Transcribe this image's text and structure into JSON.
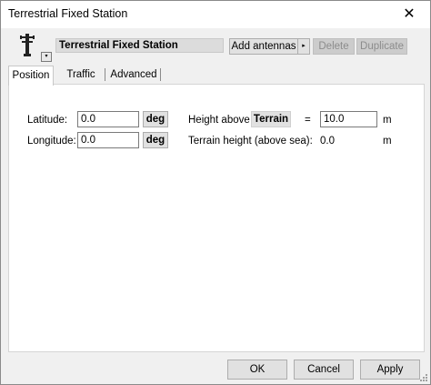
{
  "window": {
    "title": "Terrestrial Fixed Station",
    "close_glyph": "✕"
  },
  "header": {
    "icon": "radio-tower-icon",
    "dropdown_glyph": "▾",
    "station_name": "Terrestrial Fixed Station",
    "add_antennas_label": "Add antennas",
    "add_arrow_glyph": "▸",
    "delete_label": "Delete",
    "duplicate_label": "Duplicate"
  },
  "tabs": [
    {
      "label": "Position",
      "active": true
    },
    {
      "label": "Traffic",
      "active": false
    },
    {
      "label": "Advanced",
      "active": false
    }
  ],
  "position": {
    "latitude": {
      "label": "Latitude:",
      "value": "0.0",
      "unit": "deg"
    },
    "longitude": {
      "label": "Longitude:",
      "value": "0.0",
      "unit": "deg"
    },
    "height": {
      "label": "Height above",
      "reference": "Terrain",
      "equals": "=",
      "value": "10.0",
      "unit": "m"
    },
    "terrain_height": {
      "label": "Terrain height (above sea):",
      "value": "0.0",
      "unit": "m"
    }
  },
  "footer": {
    "ok_label": "OK",
    "cancel_label": "Cancel",
    "apply_label": "Apply"
  },
  "colors": {
    "window_bg": "#f0f0f0",
    "panel_bg": "#ffffff",
    "button_bg": "#e1e1e1",
    "disabled_text": "#8c8c8c"
  }
}
